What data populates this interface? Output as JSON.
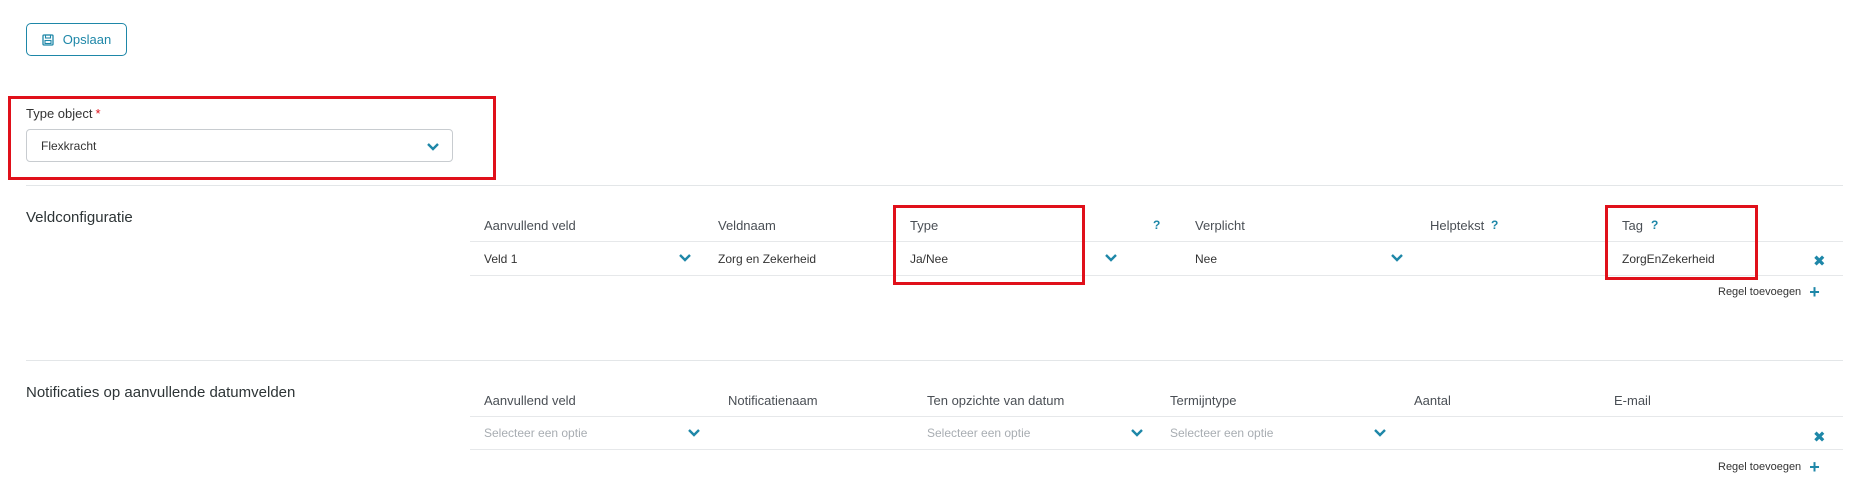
{
  "toolbar": {
    "save_label": "Opslaan"
  },
  "type_object": {
    "label": "Type object",
    "required_mark": "*",
    "value": "Flexkracht"
  },
  "veldconfiguratie": {
    "title": "Veldconfiguratie",
    "headers": {
      "aanvullend_veld": "Aanvullend veld",
      "veldnaam": "Veldnaam",
      "type": "Type",
      "type_help": "?",
      "verplicht": "Verplicht",
      "helptekst": "Helptekst",
      "helptekst_help": "?",
      "tag": "Tag",
      "tag_help": "?"
    },
    "rows": [
      {
        "aanvullend_veld": "Veld 1",
        "veldnaam": "Zorg en Zekerheid",
        "type": "Ja/Nee",
        "verplicht": "Nee",
        "helptekst": "",
        "tag": "ZorgEnZekerheid"
      }
    ],
    "add_row_label": "Regel toevoegen"
  },
  "notificaties": {
    "title": "Notificaties op aanvullende datumvelden",
    "headers": {
      "aanvullend_veld": "Aanvullend veld",
      "notificatienaam": "Notificatienaam",
      "ten_opzichte": "Ten opzichte van datum",
      "termijntype": "Termijntype",
      "aantal": "Aantal",
      "email": "E-mail"
    },
    "rows": [
      {
        "aanvullend_veld_placeholder": "Selecteer een optie",
        "ten_opzichte_placeholder": "Selecteer een optie",
        "termijntype_placeholder": "Selecteer een optie"
      }
    ],
    "add_row_label": "Regel toevoegen"
  },
  "icons": {
    "save": "floppy-disk-icon",
    "chevron": "chevron-down-icon",
    "remove": "close-icon",
    "add": "plus-icon"
  },
  "colors": {
    "accent": "#1e87a8",
    "highlight": "#e0101a"
  }
}
